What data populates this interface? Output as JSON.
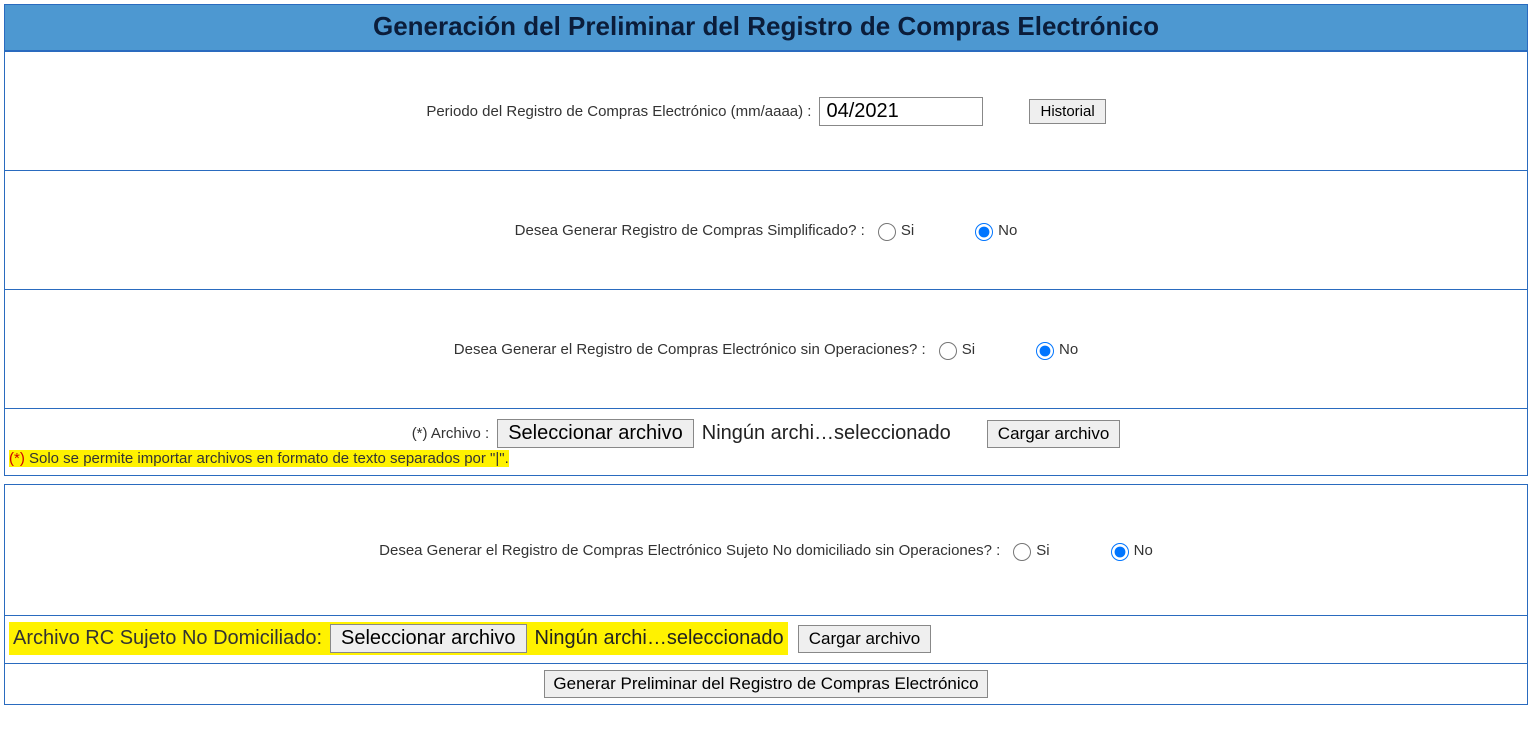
{
  "title": "Generación del Preliminar del Registro de Compras Electrónico",
  "section_periodo": {
    "label": "Periodo del Registro de Compras Electrónico (mm/aaaa)  :",
    "value": "04/2021",
    "historial_btn": "Historial"
  },
  "section_simplificado": {
    "question": "Desea Generar Registro de Compras Simplificado?  :",
    "opt_si": "Si",
    "opt_no": "No",
    "selected": "no"
  },
  "section_sin_ops": {
    "question": "Desea Generar el Registro de Compras Electrónico sin Operaciones?  :",
    "opt_si": "Si",
    "opt_no": "No",
    "selected": "no"
  },
  "section_archivo": {
    "label": "(*) Archivo  :",
    "select_btn": "Seleccionar archivo",
    "status": "Ningún archi…seleccionado",
    "cargar_btn": "Cargar archivo",
    "note_prefix": "(*)",
    "note_rest": " Solo se permite importar archivos en formato de texto separados por \"|\"."
  },
  "section_nodom": {
    "question": "Desea Generar el Registro de Compras Electrónico Sujeto No domiciliado sin Operaciones?  :",
    "opt_si": "Si",
    "opt_no": "No",
    "selected": "no"
  },
  "section_rc_file": {
    "label": "Archivo RC Sujeto No Domiciliado:",
    "select_btn": "Seleccionar archivo",
    "status": "Ningún archi…seleccionado",
    "cargar_btn": "Cargar archivo"
  },
  "generate_btn": "Generar Preliminar del Registro de Compras Electrónico"
}
